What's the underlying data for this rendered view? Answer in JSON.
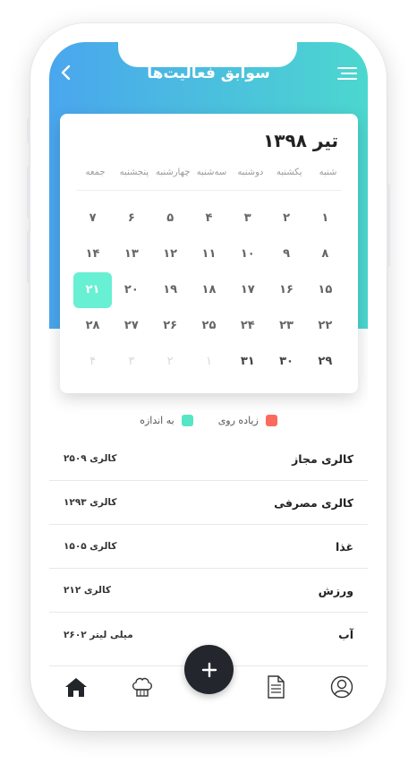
{
  "header": {
    "title": "سوابق فعالیت‌ها"
  },
  "calendar": {
    "month": "تیر ۱۳۹۸",
    "weekdays": [
      "شنبه",
      "یکشنبه",
      "دوشنبه",
      "سه‌شنبه",
      "چهارشنبه",
      "پنجشنبه",
      "جمعه"
    ],
    "days": [
      "۱",
      "۲",
      "۳",
      "۴",
      "۵",
      "۶",
      "۷",
      "۸",
      "۹",
      "۱۰",
      "۱۱",
      "۱۲",
      "۱۳",
      "۱۴",
      "۱۵",
      "۱۶",
      "۱۷",
      "۱۸",
      "۱۹",
      "۲۰",
      "۲۱",
      "۲۲",
      "۲۳",
      "۲۴",
      "۲۵",
      "۲۶",
      "۲۷",
      "۲۸",
      "۲۹",
      "۳۰",
      "۳۱",
      "۱",
      "۲",
      "۳",
      "۴"
    ],
    "selected_day": "۲۱"
  },
  "legend": {
    "over": {
      "label": "زیاده روی",
      "color": "#fb6a5d"
    },
    "normal": {
      "label": "به اندازه",
      "color": "#55e6c5"
    }
  },
  "stats": [
    {
      "label": "کالری مجاز",
      "value": "کالری ۲۵۰۹"
    },
    {
      "label": "کالری مصرفی",
      "value": "کالری ۱۲۹۳"
    },
    {
      "label": "غذا",
      "value": "کالری ۱۵۰۵"
    },
    {
      "label": "ورزش",
      "value": "کالری ۲۱۲"
    },
    {
      "label": "آب",
      "value": "میلی لیتر ۲۶۰۲"
    }
  ],
  "nav": {
    "items": [
      "profile-icon",
      "document-icon",
      "add-icon",
      "chef-hat-icon",
      "home-icon"
    ],
    "fab_symbol": "+"
  },
  "colors": {
    "header_start": "#4aa6ee",
    "header_end": "#4cd7cf",
    "selected": "#67f0d3",
    "fab": "#23272d"
  }
}
